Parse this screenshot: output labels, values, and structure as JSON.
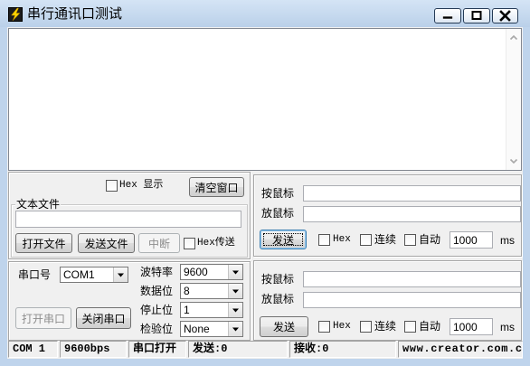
{
  "window": {
    "title": "串行通讯口测试",
    "app_icon": "lightning-bolt-icon",
    "minimize_icon": "minimize-icon",
    "maximize_icon": "maximize-icon",
    "close_icon": "close-icon"
  },
  "receive_area": {
    "text": "",
    "scroll_up_icon": "scroll-up-arrow-icon",
    "scroll_down_icon": "scroll-down-arrow-icon"
  },
  "display_options": {
    "hex_display_label": "Hex 显示",
    "hex_display_checked": false,
    "clear_window_button": "清空窗口"
  },
  "text_file": {
    "group_label": "文本文件",
    "path_value": "",
    "open_file_button": "打开文件",
    "send_file_button": "发送文件",
    "interrupt_button": "中断",
    "interrupt_enabled": false,
    "hex_send_label": "Hex传送",
    "hex_send_checked": false
  },
  "serial_settings": {
    "port_label": "串口号",
    "port_value": "COM1",
    "baud_rate_label": "波特率",
    "baud_rate_value": "9600",
    "data_bits_label": "数据位",
    "data_bits_value": "8",
    "stop_bits_label": "停止位",
    "stop_bits_value": "1",
    "parity_label": "检验位",
    "parity_value": "None",
    "open_port_button": "打开串口",
    "open_port_enabled": false,
    "close_port_button": "关闭串口"
  },
  "send_panels": [
    {
      "press_label": "按鼠标",
      "press_value": "",
      "release_label": "放鼠标",
      "release_value": "",
      "send_button": "发送",
      "hex_label": "Hex",
      "hex_checked": false,
      "continuous_label": "连续",
      "continuous_checked": false,
      "auto_label": "自动",
      "auto_checked": false,
      "interval_value": "1000",
      "interval_unit": "ms"
    },
    {
      "press_label": "按鼠标",
      "press_value": "",
      "release_label": "放鼠标",
      "release_value": "",
      "send_button": "发送",
      "hex_label": "Hex",
      "hex_checked": false,
      "continuous_label": "连续",
      "continuous_checked": false,
      "auto_label": "自动",
      "auto_checked": false,
      "interval_value": "1000",
      "interval_unit": "ms"
    }
  ],
  "status_bar": {
    "port": "COM 1",
    "baud": "9600bps",
    "state": "串口打开",
    "sent": "发送:0",
    "received": "接收:0",
    "website": "www.creator.com.c"
  },
  "colors": {
    "frame": "#bfd4ec",
    "client": "#f0f0f0",
    "disabled_text": "#8d8d8d"
  }
}
